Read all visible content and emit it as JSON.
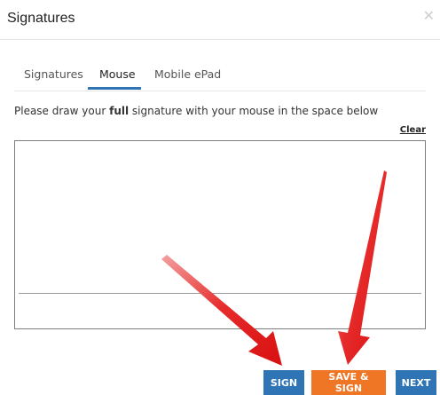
{
  "dialog": {
    "title": "Signatures",
    "close_icon": "close-icon"
  },
  "tabs": [
    {
      "label": "Signatures",
      "active": false
    },
    {
      "label": "Mouse",
      "active": true
    },
    {
      "label": "Mobile ePad",
      "active": false
    }
  ],
  "instruction": {
    "prefix": "Please draw your ",
    "bold": "full",
    "suffix": " signature with your mouse in the space below"
  },
  "pad": {
    "clear_label": "Clear"
  },
  "buttons": {
    "sign": "SIGN",
    "save_sign": "SAVE & SIGN",
    "next": "NEXT"
  },
  "colors": {
    "primary": "#2f75b5",
    "orange": "#ee7624",
    "annotation_arrow": "#e02020"
  }
}
